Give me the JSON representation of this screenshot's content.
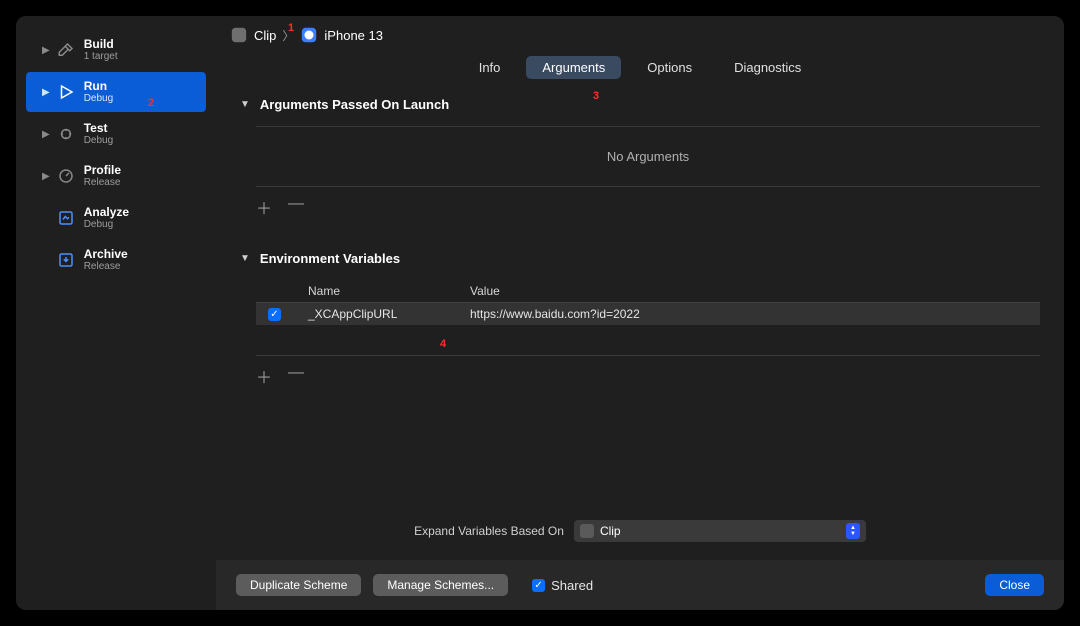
{
  "annotations": [
    "1",
    "2",
    "3",
    "4"
  ],
  "breadcrumb": {
    "scheme": "Clip",
    "device": "iPhone 13"
  },
  "sidebar": {
    "items": [
      {
        "title": "Build",
        "sub": "1 target"
      },
      {
        "title": "Run",
        "sub": "Debug"
      },
      {
        "title": "Test",
        "sub": "Debug"
      },
      {
        "title": "Profile",
        "sub": "Release"
      },
      {
        "title": "Analyze",
        "sub": "Debug"
      },
      {
        "title": "Archive",
        "sub": "Release"
      }
    ]
  },
  "tabs": [
    "Info",
    "Arguments",
    "Options",
    "Diagnostics"
  ],
  "sections": {
    "args": {
      "title": "Arguments Passed On Launch",
      "empty": "No Arguments"
    },
    "env": {
      "title": "Environment Variables",
      "headers": {
        "name": "Name",
        "value": "Value"
      },
      "rows": [
        {
          "checked": true,
          "name": "_XCAppClipURL",
          "value": "https://www.baidu.com?id=2022"
        }
      ]
    }
  },
  "expand": {
    "label": "Expand Variables Based On",
    "value": "Clip"
  },
  "footer": {
    "duplicate": "Duplicate Scheme",
    "manage": "Manage Schemes...",
    "shared": "Shared",
    "close": "Close"
  }
}
